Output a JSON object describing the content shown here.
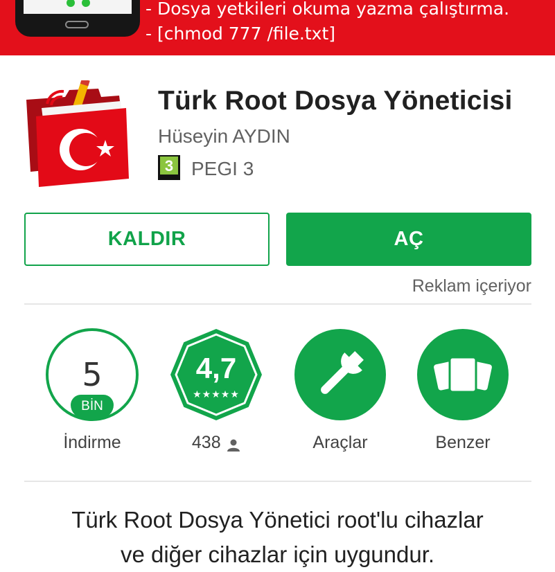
{
  "banner": {
    "line1": "- Dosya yetkileri okuma yazma çalıştırma.",
    "line2": "- [chmod 777 /file.txt]"
  },
  "app": {
    "title": "Türk Root Dosya Yöneticisi",
    "developer": "Hüseyin AYDIN",
    "pegi_number": "3",
    "pegi_label": "PEGI 3"
  },
  "actions": {
    "uninstall_label": "KALDIR",
    "open_label": "AÇ",
    "contains_ads": "Reklam içeriyor"
  },
  "stats": {
    "downloads": {
      "value": "5",
      "unit": "BİN",
      "label": "İndirme"
    },
    "rating": {
      "value": "4,7",
      "stars": 4.7,
      "stars_text": "★★★★★",
      "count": "438"
    },
    "category": {
      "label": "Araçlar",
      "icon": "wrench-icon"
    },
    "similar": {
      "label": "Benzer",
      "icon": "cards-icon"
    }
  },
  "description": {
    "line1": "Türk Root Dosya Yönetici root'lu cihazlar",
    "line2": "ve diğer cihazlar için uygundur."
  },
  "colors": {
    "accent_green": "#12a54b",
    "banner_red": "#e3101b",
    "flag_red": "#e30a17"
  }
}
